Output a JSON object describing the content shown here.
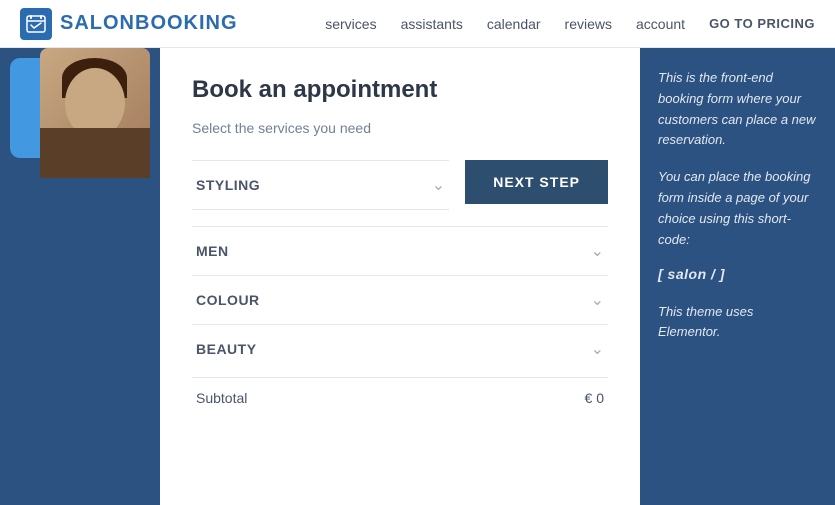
{
  "header": {
    "logo_text": "SALONBOOKING",
    "nav": {
      "services": "services",
      "assistants": "assistants",
      "calendar": "calendar",
      "reviews": "reviews",
      "account": "account",
      "pricing": "GO TO PRICING"
    }
  },
  "booking": {
    "title": "Book an appointment",
    "subtitle": "Select the services you need",
    "services": [
      {
        "label": "STYLING"
      },
      {
        "label": "MEN"
      },
      {
        "label": "COLOUR"
      },
      {
        "label": "BEAUTY"
      }
    ],
    "next_step_label": "NEXT STEP",
    "subtotal_label": "Subtotal",
    "subtotal_value": "€ 0"
  },
  "info": {
    "line1": "This is the front-end booking form where your customers can place a new reservation.",
    "line2": "You can place the booking form inside a page of your choice using this short-code:",
    "shortcode": "[ salon / ]",
    "footer": "This theme uses Elementor."
  }
}
